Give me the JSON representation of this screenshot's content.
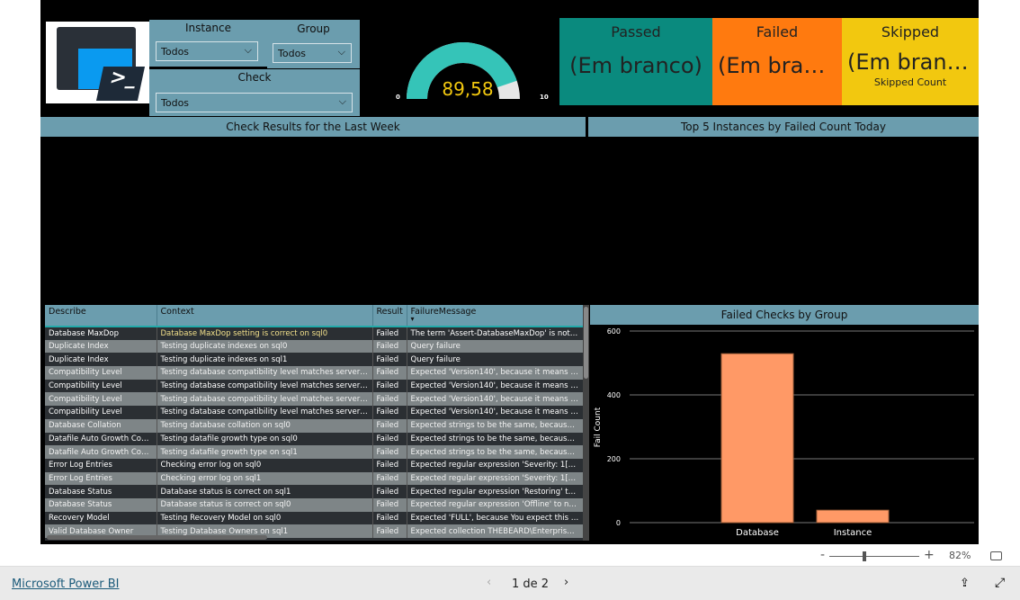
{
  "slicers": {
    "instance": {
      "label": "Instance",
      "value": "Todos"
    },
    "group": {
      "label": "Group",
      "value": "Todos"
    },
    "check": {
      "label": "Check",
      "value": "Todos"
    }
  },
  "gauge": {
    "value": 89.58,
    "value_text": "89,58",
    "min": "0",
    "max": "100",
    "color": "#35c4b8",
    "value_color": "#f2c80f"
  },
  "cards": [
    {
      "title": "Passed",
      "value": "(Em branco)",
      "color": "#0a8a7e"
    },
    {
      "title": "Failed",
      "value": "(Em branco)",
      "color": "#ff7a0f"
    },
    {
      "title": "Skipped",
      "value": "(Em branco)",
      "subtitle": "Skipped Count",
      "color": "#f2c80f"
    }
  ],
  "headers": {
    "week": "Check Results for the Last Week",
    "top5": "Top 5 Instances by Failed Count Today",
    "group": "Failed Checks by Group"
  },
  "table": {
    "columns": [
      "Describe",
      "Context",
      "Result",
      "FailureMessage"
    ],
    "rows": [
      [
        "Database MaxDop",
        "Database MaxDop setting is correct on sql0",
        "Failed",
        "The term 'Assert-DatabaseMaxDop' is not recogni"
      ],
      [
        "Duplicate Index",
        "Testing duplicate indexes on sql0",
        "Failed",
        "Query failure"
      ],
      [
        "Duplicate Index",
        "Testing duplicate indexes on sql1",
        "Failed",
        "Query failure"
      ],
      [
        "Compatibility Level",
        "Testing database compatibility level matches server compa...",
        "Failed",
        "Expected 'Version140', because it means you are c"
      ],
      [
        "Compatibility Level",
        "Testing database compatibility level matches server compa...",
        "Failed",
        "Expected 'Version140', because it means you are c"
      ],
      [
        "Compatibility Level",
        "Testing database compatibility level matches server compa...",
        "Failed",
        "Expected 'Version140', because it means you are c"
      ],
      [
        "Compatibility Level",
        "Testing database compatibility level matches server compa...",
        "Failed",
        "Expected 'Version140', because it means you are c"
      ],
      [
        "Database Collation",
        "Testing database collation on sql0",
        "Failed",
        "Expected strings to be the same, because You will"
      ],
      [
        "Datafile Auto Growth Config...",
        "Testing datafile growth type on sql0",
        "Failed",
        "Expected strings to be the same, because We expe"
      ],
      [
        "Datafile Auto Growth Config...",
        "Testing datafile growth type on sql1",
        "Failed",
        "Expected strings to be the same, because We expe"
      ],
      [
        "Error Log Entries",
        "Checking error log on sql0",
        "Failed",
        "Expected regular expression 'Severity: 1[7-9]' to no"
      ],
      [
        "Error Log Entries",
        "Checking error log on sql1",
        "Failed",
        "Expected regular expression 'Severity: 1[7-9]' to no"
      ],
      [
        "Database Status",
        "Database status is correct on sql1",
        "Failed",
        "Expected regular expression 'Restoring' to not ma"
      ],
      [
        "Database Status",
        "Database status is correct on sql0",
        "Failed",
        "Expected regular expression 'Offline' to not match"
      ],
      [
        "Recovery Model",
        "Testing Recovery Model on sql0",
        "Failed",
        "Expected 'FULL', because You expect this recovery"
      ],
      [
        "Valid Database Owner",
        "Testing Database Owners on sql1",
        "Failed",
        "Expected collection THEBEARD\\EnterpriseAdmin t"
      ]
    ]
  },
  "chart_data": {
    "type": "bar",
    "categories": [
      "Database",
      "Instance"
    ],
    "values": [
      529,
      39
    ],
    "ylabel": "Fail Count",
    "ylim": [
      0,
      600
    ],
    "yticks": [
      "0",
      "200",
      "400",
      "600"
    ],
    "grid": true,
    "bar_color": "#ff9966"
  },
  "zoom": {
    "minus": "-",
    "plus": "+",
    "level": "82%"
  },
  "footer": {
    "brand": "Microsoft Power BI",
    "page": "1 de 2"
  }
}
